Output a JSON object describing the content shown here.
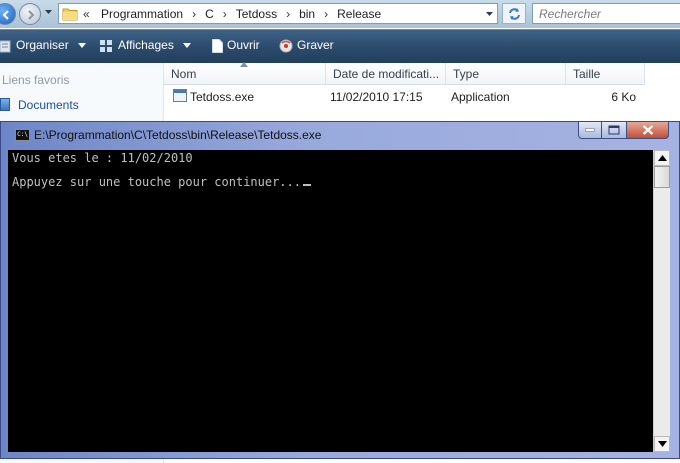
{
  "explorer": {
    "address": {
      "overflow_glyph": "«",
      "segments": [
        "Programmation",
        "C",
        "Tetdoss",
        "bin",
        "Release"
      ]
    },
    "search_placeholder": "Rechercher",
    "toolbar": {
      "organize": "Organiser",
      "views": "Affichages",
      "open": "Ouvrir",
      "burn": "Graver"
    },
    "nav": {
      "favorites_header": "Liens favoris",
      "documents": "Documents"
    },
    "columns": {
      "name": "Nom",
      "date": "Date de modificati...",
      "type": "Type",
      "size": "Taille"
    },
    "files": [
      {
        "name": "Tetdoss.exe",
        "date": "11/02/2010 17:15",
        "type": "Application",
        "size": "6 Ko",
        "icon": "exe-file-icon"
      }
    ]
  },
  "console": {
    "title": "E:\\Programmation\\C\\Tetdoss\\bin\\Release\\Tetdoss.exe",
    "icon_label": "C:\\",
    "lines": [
      "Vous etes le : 11/02/2010",
      "Appuyez sur une touche pour continuer..."
    ]
  },
  "colors": {
    "console_bg": "#000000",
    "console_text": "#c0c0c0",
    "toolbar_bg": "#2b4a6b",
    "title_gradient": "#98a9dc"
  }
}
